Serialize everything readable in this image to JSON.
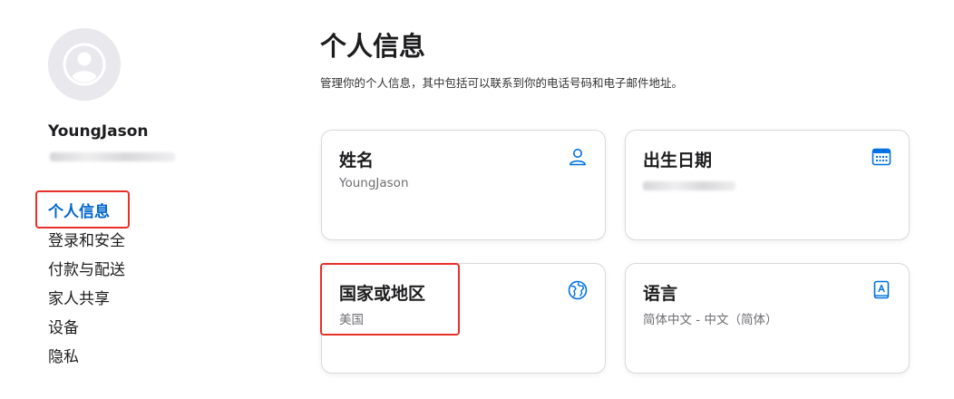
{
  "profile": {
    "name": "YoungJason"
  },
  "nav": {
    "items": [
      {
        "label": "个人信息"
      },
      {
        "label": "登录和安全"
      },
      {
        "label": "付款与配送"
      },
      {
        "label": "家人共享"
      },
      {
        "label": "设备"
      },
      {
        "label": "隐私"
      }
    ],
    "active_index": 0
  },
  "main": {
    "title": "个人信息",
    "description": "管理你的个人信息，其中包括可以联系到你的电话号码和电子邮件地址。",
    "cards": [
      {
        "title": "姓名",
        "value": "YoungJason",
        "icon": "person-icon"
      },
      {
        "title": "出生日期",
        "value": "",
        "icon": "calendar-icon"
      },
      {
        "title": "国家或地区",
        "value": "美国",
        "icon": "globe-icon"
      },
      {
        "title": "语言",
        "value": "简体中文 - 中文（简体）",
        "icon": "book-icon"
      }
    ]
  },
  "colors": {
    "accent": "#0066cc",
    "highlight": "#e8302a",
    "icon": "#0071e3"
  }
}
